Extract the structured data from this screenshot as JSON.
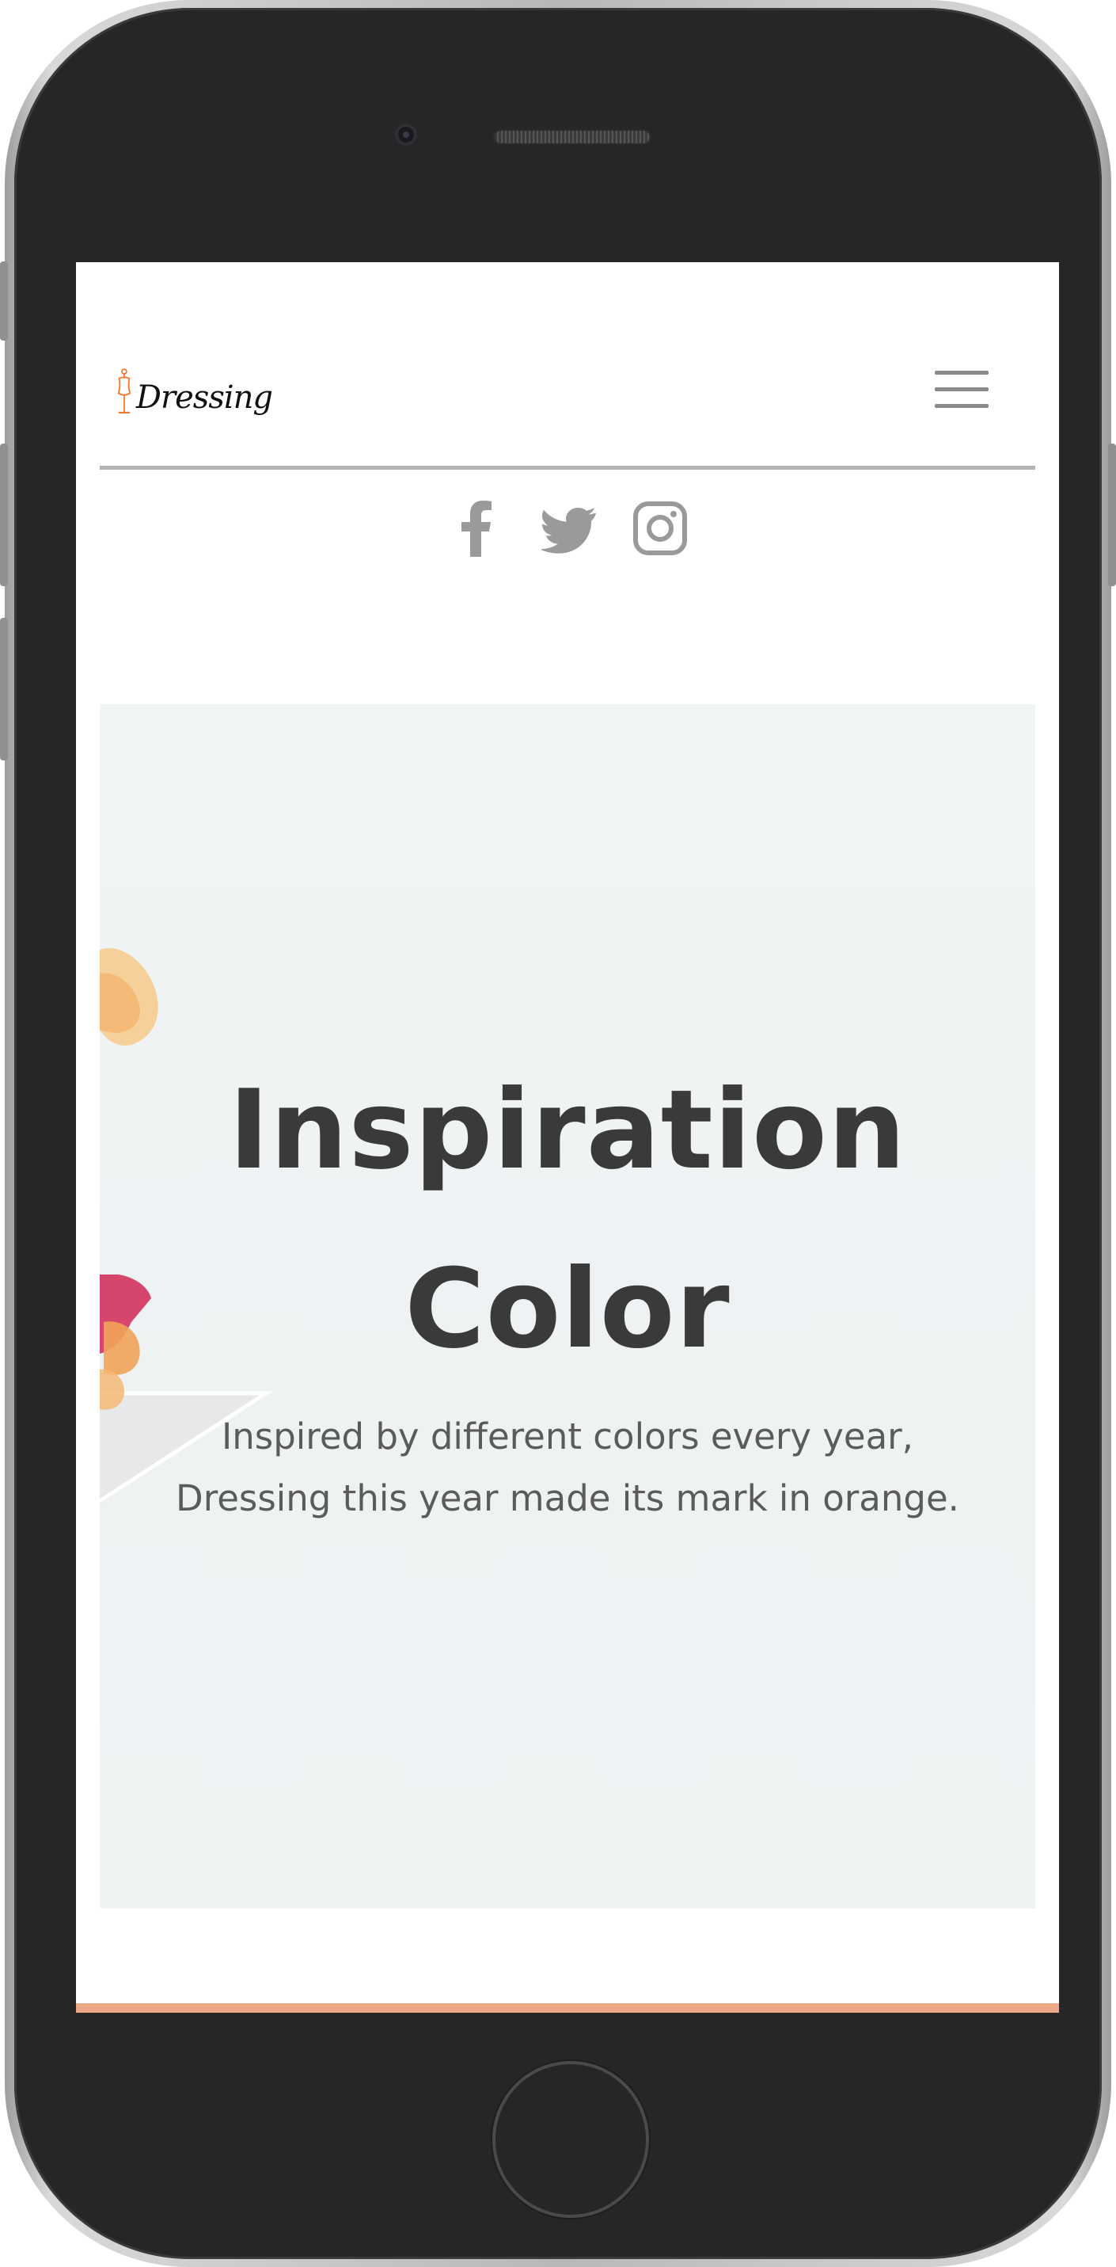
{
  "app": {
    "logo_text": "Dressing",
    "accent_color": "#eeaa88",
    "logo_color": "#f07a2c"
  },
  "header": {
    "menu_icon": "hamburger-menu-icon"
  },
  "social": [
    {
      "icon": "facebook-icon"
    },
    {
      "icon": "twitter-icon"
    },
    {
      "icon": "instagram-icon"
    }
  ],
  "hero": {
    "title_lines": [
      "Inspiration",
      "Color"
    ],
    "subtitle_lines": [
      "Inspired by different colors every year,",
      "Dressing this year made its mark in orange."
    ],
    "background_color": "#f0f3f4",
    "text_color": "#3a3a3a"
  }
}
